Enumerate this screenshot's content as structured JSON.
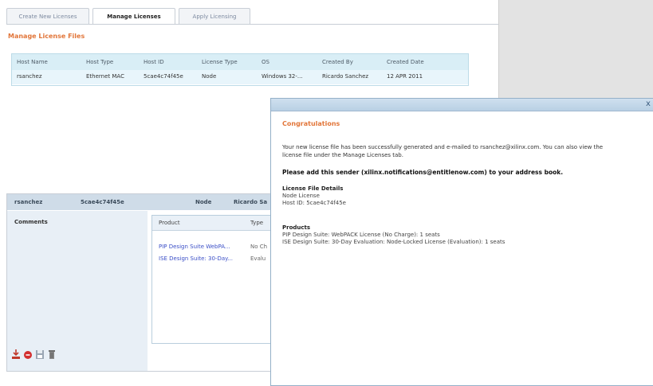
{
  "tabs": [
    {
      "label": "Create New Licenses"
    },
    {
      "label": "Manage Licenses"
    },
    {
      "label": "Apply Licensing"
    }
  ],
  "section_title": "Manage License Files",
  "license_table": {
    "columns": [
      "Host Name",
      "Host Type",
      "Host ID",
      "License Type",
      "OS",
      "Created By",
      "Created Date"
    ],
    "rows": [
      [
        "rsanchez",
        "Ethernet MAC",
        "5cae4c74f45e",
        "Node",
        "Windows 32-...",
        "Ricardo Sanchez",
        "12 APR 2011"
      ]
    ]
  },
  "detail_bar": {
    "host": "rsanchez",
    "host_id": "5cae4c74f45e",
    "type": "Node",
    "created_by": "Ricardo Sa"
  },
  "comments_label": "Comments",
  "product_list": {
    "columns": [
      "Product",
      "Type"
    ],
    "rows": [
      {
        "product": "PIP Design Suite WebPA...",
        "type": "No Ch"
      },
      {
        "product": "ISE Design Suite: 30-Day...",
        "type": "Evalu"
      }
    ]
  },
  "action_icons": [
    "download-icon",
    "delete-red-icon",
    "save-icon",
    "trash-icon"
  ],
  "dialog": {
    "close_label": "x",
    "congrats": "Congratulations",
    "message": "Your new license file has been successfully generated and e-mailed to rsanchez@xilinx.com. You can also view the license file under the Manage Licenses tab.",
    "add_sender": "Please add this sender (xilinx.notifications@entitlenow.com) to your address book.",
    "details_title": "License File Details",
    "details_lines": [
      "Node License",
      "Host ID: 5cae4c74f45e"
    ],
    "products_title": "Products",
    "product_lines": [
      "PIP Design Suite: WebPACK License (No Charge): 1 seats",
      "ISE Design Suite: 30-Day Evaluation: Node-Locked License (Evaluation): 1 seats"
    ]
  },
  "colors": {
    "accent_orange": "#e2763a",
    "link_blue": "#3b4fc7",
    "table_header": "#d9eef6",
    "right_pane": "#e3e3e3"
  }
}
